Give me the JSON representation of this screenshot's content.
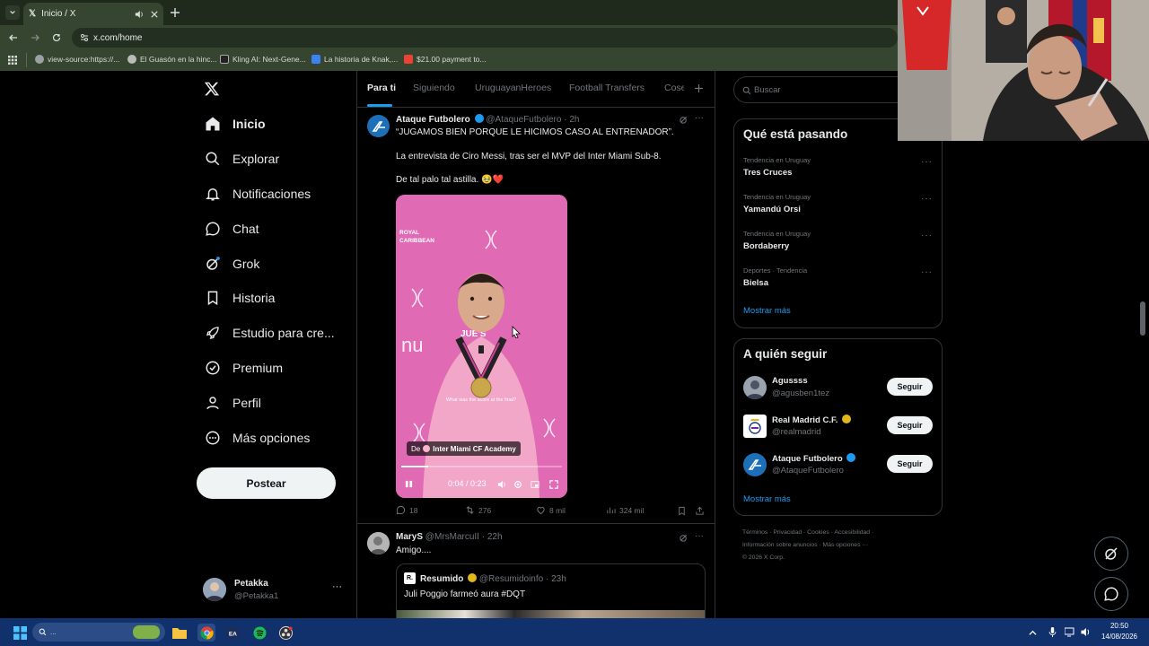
{
  "browser": {
    "tab_title": "Inicio / X",
    "url": "x.com/home",
    "bookmarks": [
      {
        "label": "view-source:https://...",
        "color": "#9aa0a6"
      },
      {
        "label": "El Guasón en la hinc...",
        "color": "#bbbbbb"
      },
      {
        "label": "Kling AI: Next-Gene...",
        "color": "#222222"
      },
      {
        "label": "La historia de Knak,...",
        "color": "#3b82f6"
      },
      {
        "label": "$21.00 payment to...",
        "color": "#ea4335"
      }
    ]
  },
  "sidebar": {
    "items": [
      {
        "label": "Inicio",
        "icon": "home-icon"
      },
      {
        "label": "Explorar",
        "icon": "search-icon"
      },
      {
        "label": "Notificaciones",
        "icon": "bell-icon"
      },
      {
        "label": "Chat",
        "icon": "chat-icon"
      },
      {
        "label": "Grok",
        "icon": "grok-icon"
      },
      {
        "label": "Historia",
        "icon": "bookmark-icon"
      },
      {
        "label": "Estudio para cre...",
        "icon": "rocket-icon"
      },
      {
        "label": "Premium",
        "icon": "verified-icon"
      },
      {
        "label": "Perfil",
        "icon": "person-icon"
      },
      {
        "label": "Más opciones",
        "icon": "more-circle-icon"
      }
    ],
    "post_button": "Postear",
    "account": {
      "name": "Petakka",
      "handle": "@Petakka1"
    }
  },
  "feed": {
    "tabs": [
      "Para ti",
      "Siguiendo",
      "UruguayanHeroes",
      "Football Transfers",
      "Cose"
    ],
    "post1": {
      "author": "Ataque Futbolero",
      "handle": "@AtaqueFutbolero",
      "time": "· 2h",
      "line1": "“JUGAMOS BIEN PORQUE LE HICIMOS CASO AL ENTRENADOR”.",
      "line2": "La entrevista de Ciro Messi, tras ser el MVP del Inter Miami Sub-8.",
      "line3": "De tal palo tal astilla. 🥹❤️",
      "video": {
        "sponsor": "ROYAL CARIBBEAN",
        "caption": "What was the score at the final?",
        "source_prefix": "De",
        "source_name": "Inter Miami CF Academy",
        "time": "0:04 / 0:23",
        "progress": 0.17
      },
      "stats": {
        "replies": "18",
        "reposts": "276",
        "likes": "8 mil",
        "views": "324 mil"
      }
    },
    "post2": {
      "author": "MaryS",
      "handle": "@MrsMarcuII",
      "time": "· 22h",
      "text": "Amigo....",
      "quote": {
        "author": "Resumido",
        "handle": "@Resumidoinfo",
        "time": "· 23h",
        "text": "Juli Poggio farmeó aura #DQT"
      }
    }
  },
  "right": {
    "search_placeholder": "Buscar",
    "trends_title": "Qué está pasando",
    "trends": [
      {
        "category": "Tendencia en Uruguay",
        "name": "Tres Cruces"
      },
      {
        "category": "Tendencia en Uruguay",
        "name": "Yamandú Orsi"
      },
      {
        "category": "Tendencia en Uruguay",
        "name": "Bordaberry"
      },
      {
        "category": "Deportes · Tendencia",
        "name": "Bielsa"
      }
    ],
    "trends_more": "Mostrar más",
    "follow_title": "A quién seguir",
    "follow": [
      {
        "name": "Agussss",
        "handle": "@agusben1tez",
        "button": "Seguir",
        "verified": false
      },
      {
        "name": "Real Madrid C.F.",
        "handle": "@realmadrid",
        "button": "Seguir",
        "verified": true
      },
      {
        "name": "Ataque Futbolero",
        "handle": "@AtaqueFutbolero",
        "button": "Seguir",
        "verified": true
      }
    ],
    "follow_more": "Mostrar más",
    "footer": {
      "line1": [
        "Términos",
        "Privacidad",
        "Cookies",
        "Accesibilidad"
      ],
      "line2": [
        "Información sobre anuncios",
        "Más opciones ···"
      ],
      "copyright": "© 2026 X Corp."
    }
  },
  "taskbar": {
    "search_text": "...",
    "time": "20:50",
    "date": "14/08/2026"
  },
  "colors": {
    "accent": "#1d9bf0",
    "verified_gold": "#e2b719",
    "like_red": "#f91880"
  }
}
